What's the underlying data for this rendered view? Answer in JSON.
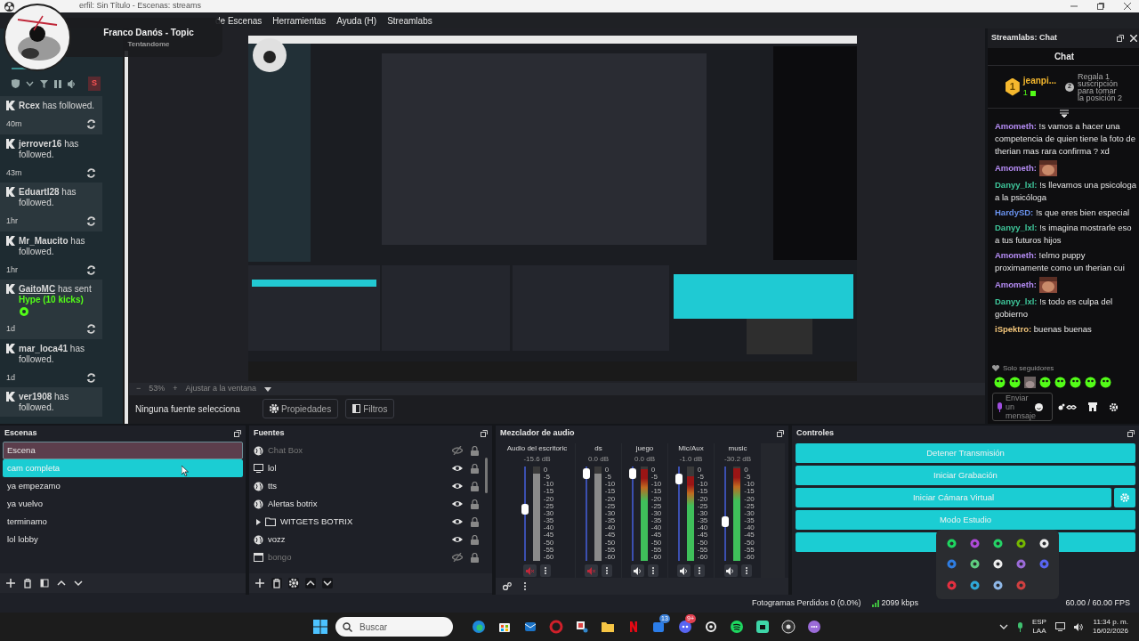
{
  "window": {
    "title": "erfil: Sin Título - Escenas: streams"
  },
  "menu": [
    {
      "label": "de Escenas"
    },
    {
      "label": "Herramientas"
    },
    {
      "label": "Ayuda (H)"
    },
    {
      "label": "Streamlabs"
    }
  ],
  "now_playing": {
    "title": "Franco Danós - Topic",
    "subtitle": "Tentandome"
  },
  "alerts_panel": {
    "toolbar_button": "S",
    "events": [
      {
        "user": "Rcex",
        "text": "has followed.",
        "time": "40m"
      },
      {
        "user": "jerrover16",
        "text": "has followed.",
        "time": "43m"
      },
      {
        "user": "Eduartl28",
        "text": "has followed.",
        "time": "1hr"
      },
      {
        "user": "Mr_Maucito",
        "text": "has followed.",
        "time": "1hr"
      },
      {
        "user": "GaitoMC",
        "text": "has sent",
        "highlight": "Hype (10 kicks)",
        "time": "1d"
      },
      {
        "user": "mar_loca41",
        "text": "has followed.",
        "time": "1d"
      },
      {
        "user": "ver1908",
        "text": "has followed."
      }
    ]
  },
  "preview": {
    "zoom": {
      "minus": "−",
      "value": "53%",
      "plus": "+",
      "fit": "Ajustar a la ventana"
    }
  },
  "source_bar": {
    "status": "Ninguna fuente selecciona",
    "buttons": [
      "Propiedades",
      "Filtros"
    ]
  },
  "chat": {
    "dock_title": "Streamlabs: Chat",
    "title": "Chat",
    "top": {
      "rank": "1",
      "name": "jeanpi...",
      "count": "1",
      "next_rank": "2",
      "cta": "Regala 1 suscripción para tomar la posición 2"
    },
    "messages": [
      {
        "user": "Amometh:",
        "color": "#b58cf5",
        "text": "!s vamos a hacer una competencia de quien tiene la foto de therian mas rara confirma ? xd"
      },
      {
        "user": "Amometh:",
        "color": "#b58cf5",
        "kind": "emote"
      },
      {
        "user": "Danyy_lxl:",
        "color": "#3fc79b",
        "text": "!s llevamos una psicologa a la psicóloga"
      },
      {
        "user": "HardySD:",
        "color": "#6a93f0",
        "text": "!s que eres bien especial"
      },
      {
        "user": "Danyy_lxl:",
        "color": "#3fc79b",
        "text": "!s imagina mostrarle eso a tus futuros hijos"
      },
      {
        "user": "Amometh:",
        "color": "#b58cf5",
        "text": "!elmo puppy proximamente como un therian cui"
      },
      {
        "user": "Amometh:",
        "color": "#b58cf5",
        "kind": "emote"
      },
      {
        "user": "Danyy_lxl:",
        "color": "#3fc79b",
        "text": "!s todo es culpa del gobierno"
      },
      {
        "user": "iSpektro:",
        "color": "#f2c57a",
        "text": "buenas buenas"
      }
    ],
    "mode": "Solo seguidores",
    "input": {
      "placeholder": "Enviar un mensaje"
    }
  },
  "scenes": {
    "title": "Escenas",
    "items": [
      {
        "name": "Escena",
        "selected": false,
        "highlighted": true
      },
      {
        "name": "cam completa",
        "selected": true,
        "highlighted": false
      },
      {
        "name": "ya empezamo",
        "selected": false,
        "highlighted": false
      },
      {
        "name": "ya vuelvo",
        "selected": false,
        "highlighted": false
      },
      {
        "name": "terminamo",
        "selected": false,
        "highlighted": false
      },
      {
        "name": "lol lobby",
        "selected": false,
        "highlighted": false
      }
    ]
  },
  "sources": {
    "title": "Fuentes",
    "items": [
      {
        "name": "Chat Box",
        "kind": "browser",
        "visible": false
      },
      {
        "name": "lol",
        "kind": "display",
        "visible": true
      },
      {
        "name": "tts",
        "kind": "browser",
        "visible": true
      },
      {
        "name": "Alertas botrix",
        "kind": "browser",
        "visible": true
      },
      {
        "name": "WITGETS BOTRIX",
        "kind": "group",
        "visible": true
      },
      {
        "name": "vozz",
        "kind": "browser",
        "visible": true
      },
      {
        "name": "bongo",
        "kind": "window",
        "visible": false
      }
    ]
  },
  "mixer": {
    "title": "Mezclador de audio",
    "channels": [
      {
        "name": "Audio del escritoric",
        "reading": "-15.6 dB",
        "level": 0.55,
        "muted": true,
        "meter": {
          "level": 0.92
        },
        "scale": [
          "0",
          "-5",
          "-10",
          "-15",
          "-20",
          "-25",
          "-30",
          "-35",
          "-40",
          "-45",
          "-50",
          "-55",
          "-60"
        ]
      },
      {
        "name": "ds",
        "reading": "0.0 dB",
        "level": 0.98,
        "muted": true,
        "meter": {
          "level": 0.92
        },
        "scale": [
          "0",
          "-5",
          "-10",
          "-15",
          "-20",
          "-25",
          "-30",
          "-35",
          "-40",
          "-45",
          "-50",
          "-55",
          "-60"
        ]
      },
      {
        "name": "juego",
        "reading": "0.0 dB",
        "level": 0.98,
        "muted": false,
        "meter": {
          "level": 0.97
        },
        "scale": [
          "0",
          "-5",
          "-10",
          "-15",
          "-20",
          "-25",
          "-30",
          "-35",
          "-40",
          "-45",
          "-50",
          "-55",
          "-60"
        ]
      },
      {
        "name": "Mic/Aux",
        "reading": "-1.0 dB",
        "level": 0.92,
        "muted": false,
        "meter": {
          "level": 0.9
        },
        "scale": [
          "0",
          "-5",
          "-10",
          "-15",
          "-20",
          "-25",
          "-30",
          "-35",
          "-40",
          "-45",
          "-50",
          "-55",
          "-60"
        ]
      },
      {
        "name": "music",
        "reading": "-30.2 dB",
        "level": 0.4,
        "muted": false,
        "meter": {
          "level": 0.98
        },
        "scale": [
          "0",
          "-5",
          "-10",
          "-15",
          "-20",
          "-25",
          "-30",
          "-35",
          "-40",
          "-45",
          "-50",
          "-55",
          "-60"
        ]
      }
    ]
  },
  "controls": {
    "title": "Controles",
    "buttons": [
      {
        "label": "Detener Transmisión",
        "settings": false
      },
      {
        "label": "Iniciar Grabación",
        "settings": false
      },
      {
        "label": "Iniciar Cámara Virtual",
        "settings": true
      },
      {
        "label": "Modo Estudio",
        "settings": false
      },
      {
        "settings": false
      }
    ]
  },
  "status_bar": {
    "dropped": "Fotogramas Perdidos 0 (0.0%)",
    "bitrate": "2099 kbps",
    "fps": "60.00 / 60.00 FPS"
  },
  "taskbar": {
    "search": {
      "placeholder": "Buscar"
    },
    "badges": [
      {
        "text": "13"
      },
      {
        "text": "9+"
      }
    ],
    "language": "ESP",
    "layout": "LAA",
    "time": "11:34 p. m.",
    "date": "16/02/2026"
  }
}
